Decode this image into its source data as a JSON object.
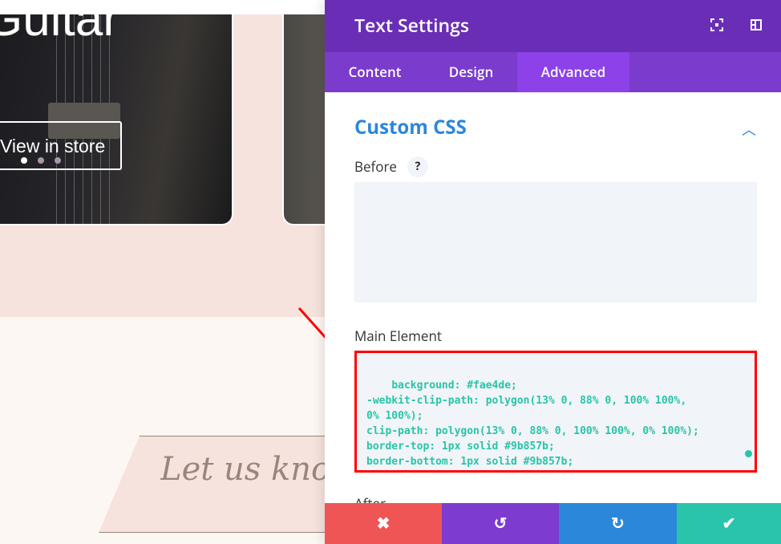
{
  "page": {
    "hero_title": "Guitar",
    "store_button": "View in store",
    "slider_dots": 3,
    "active_dot": 0,
    "banner_text": "Let us know"
  },
  "panel": {
    "title": "Text Settings",
    "header_icons": [
      "fullscreen-icon",
      "sidebar-layout-icon"
    ],
    "tabs": [
      {
        "label": "Content",
        "active": false
      },
      {
        "label": "Design",
        "active": false
      },
      {
        "label": "Advanced",
        "active": true
      }
    ],
    "section_title": "Custom CSS",
    "fields": {
      "before_label": "Before",
      "help": "?",
      "before_value": "",
      "main_label": "Main Element",
      "main_value": "background: #fae4de;\n-webkit-clip-path: polygon(13% 0, 88% 0, 100% 100%,\n0% 100%);\nclip-path: polygon(13% 0, 88% 0, 100% 100%, 0% 100%);\nborder-top: 1px solid #9b857b;\nborder-bottom: 1px solid #9b857b;",
      "after_label": "After"
    },
    "footer": {
      "cancel": "✖",
      "undo": "↺",
      "redo": "↻",
      "save": "✔"
    }
  },
  "colors": {
    "header": "#6a2eb6",
    "accent": "#2b87da",
    "cancel": "#ef5555",
    "undo": "#7d3bcf",
    "redo": "#2b87da",
    "save": "#29c4a9",
    "highlight": "#ff0000"
  }
}
